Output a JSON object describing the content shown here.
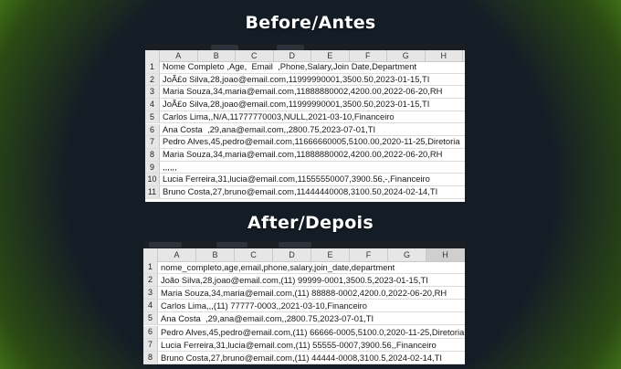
{
  "before": {
    "title": "Before/Antes",
    "columns": [
      "A",
      "B",
      "C",
      "D",
      "E",
      "F",
      "G",
      "H"
    ],
    "rows": [
      {
        "n": "1",
        "text": "Nome Completo ,Age,  Email  ,Phone,Salary,Join Date,Department"
      },
      {
        "n": "2",
        "text": "JoÃ£o Silva,28,joao@email.com,11999990001,3500.50,2023-01-15,TI"
      },
      {
        "n": "3",
        "text": "Maria Souza,34,maria@email.com,11888880002,4200.00,2022-06-20,RH"
      },
      {
        "n": "4",
        "text": "JoÃ£o Silva,28,joao@email.com,11999990001,3500.50,2023-01-15,TI"
      },
      {
        "n": "5",
        "text": "Carlos Lima,,N/A,11777770003,NULL,2021-03-10,Financeiro"
      },
      {
        "n": "6",
        "text": "Ana Costa  ,29,ana@email.com,,2800.75,2023-07-01,TI"
      },
      {
        "n": "7",
        "text": "Pedro Alves,45,pedro@email.com,11666660005,5100.00,2020-11-25,Diretoria"
      },
      {
        "n": "8",
        "text": "Maria Souza,34,maria@email.com,11888880002,4200.00,2022-06-20,RH"
      },
      {
        "n": "9",
        "text": ",,,,,,"
      },
      {
        "n": "10",
        "text": "Lucia Ferreira,31,lucia@email.com,11555550007,3900.56,-,Financeiro"
      },
      {
        "n": "11",
        "text": "Bruno Costa,27,bruno@email.com,11444440008,3100.50,2024-02-14,TI"
      }
    ]
  },
  "after": {
    "title": "After/Depois",
    "columns": [
      "A",
      "B",
      "C",
      "D",
      "E",
      "F",
      "G",
      "H"
    ],
    "selected_column": "H",
    "rows": [
      {
        "n": "1",
        "text": "nome_completo,age,email,phone,salary,join_date,department"
      },
      {
        "n": "2",
        "text": "João Silva,28,joao@email.com,(11) 99999-0001,3500.5,2023-01-15,TI"
      },
      {
        "n": "3",
        "text": "Maria Souza,34,maria@email.com,(11) 88888-0002,4200.0,2022-06-20,RH"
      },
      {
        "n": "4",
        "text": "Carlos Lima,,,(11) 77777-0003,,2021-03-10,Financeiro"
      },
      {
        "n": "5",
        "text": "Ana Costa  ,29,ana@email.com,,2800.75,2023-07-01,TI"
      },
      {
        "n": "6",
        "text": "Pedro Alves,45,pedro@email.com,(11) 66666-0005,5100.0,2020-11-25,Diretoria"
      },
      {
        "n": "7",
        "text": "Lucia Ferreira,31,lucia@email.com,(11) 55555-0007,3900.56,,Financeiro"
      },
      {
        "n": "8",
        "text": "Bruno Costa,27,bruno@email.com,(11) 44444-0008,3100.5,2024-02-14,TI"
      }
    ]
  }
}
